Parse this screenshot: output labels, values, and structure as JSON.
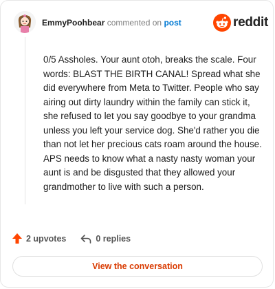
{
  "header": {
    "username": "EmmyPoohbear",
    "action_text": "commented on",
    "post_link": "post"
  },
  "brand": {
    "wordmark": "reddit",
    "icon": "reddit-snoo-icon",
    "color": "#ff4500"
  },
  "comment": {
    "body": "0/5 Assholes. Your aunt otoh, breaks the scale. Four words: BLAST THE BIRTH CANAL! Spread what she did everywhere from Meta to Twitter. People who say airing out dirty laundry within the family can stick it, she refused to let you say goodbye to your grandma unless you left your service dog. She'd rather you die than not let her precious cats roam around the house. APS needs to know what a nasty nasty woman your aunt is and be disgusted that they allowed your grandmother to live with such a person."
  },
  "stats": {
    "upvotes_label": "2 upvotes",
    "upvote_icon": "upvote-arrow-icon",
    "replies_label": "0 replies",
    "reply_icon": "reply-arrow-icon"
  },
  "cta": {
    "label": "View the conversation"
  },
  "colors": {
    "accent": "#d93a00",
    "upvote": "#ff4500",
    "link": "#0079d3"
  }
}
